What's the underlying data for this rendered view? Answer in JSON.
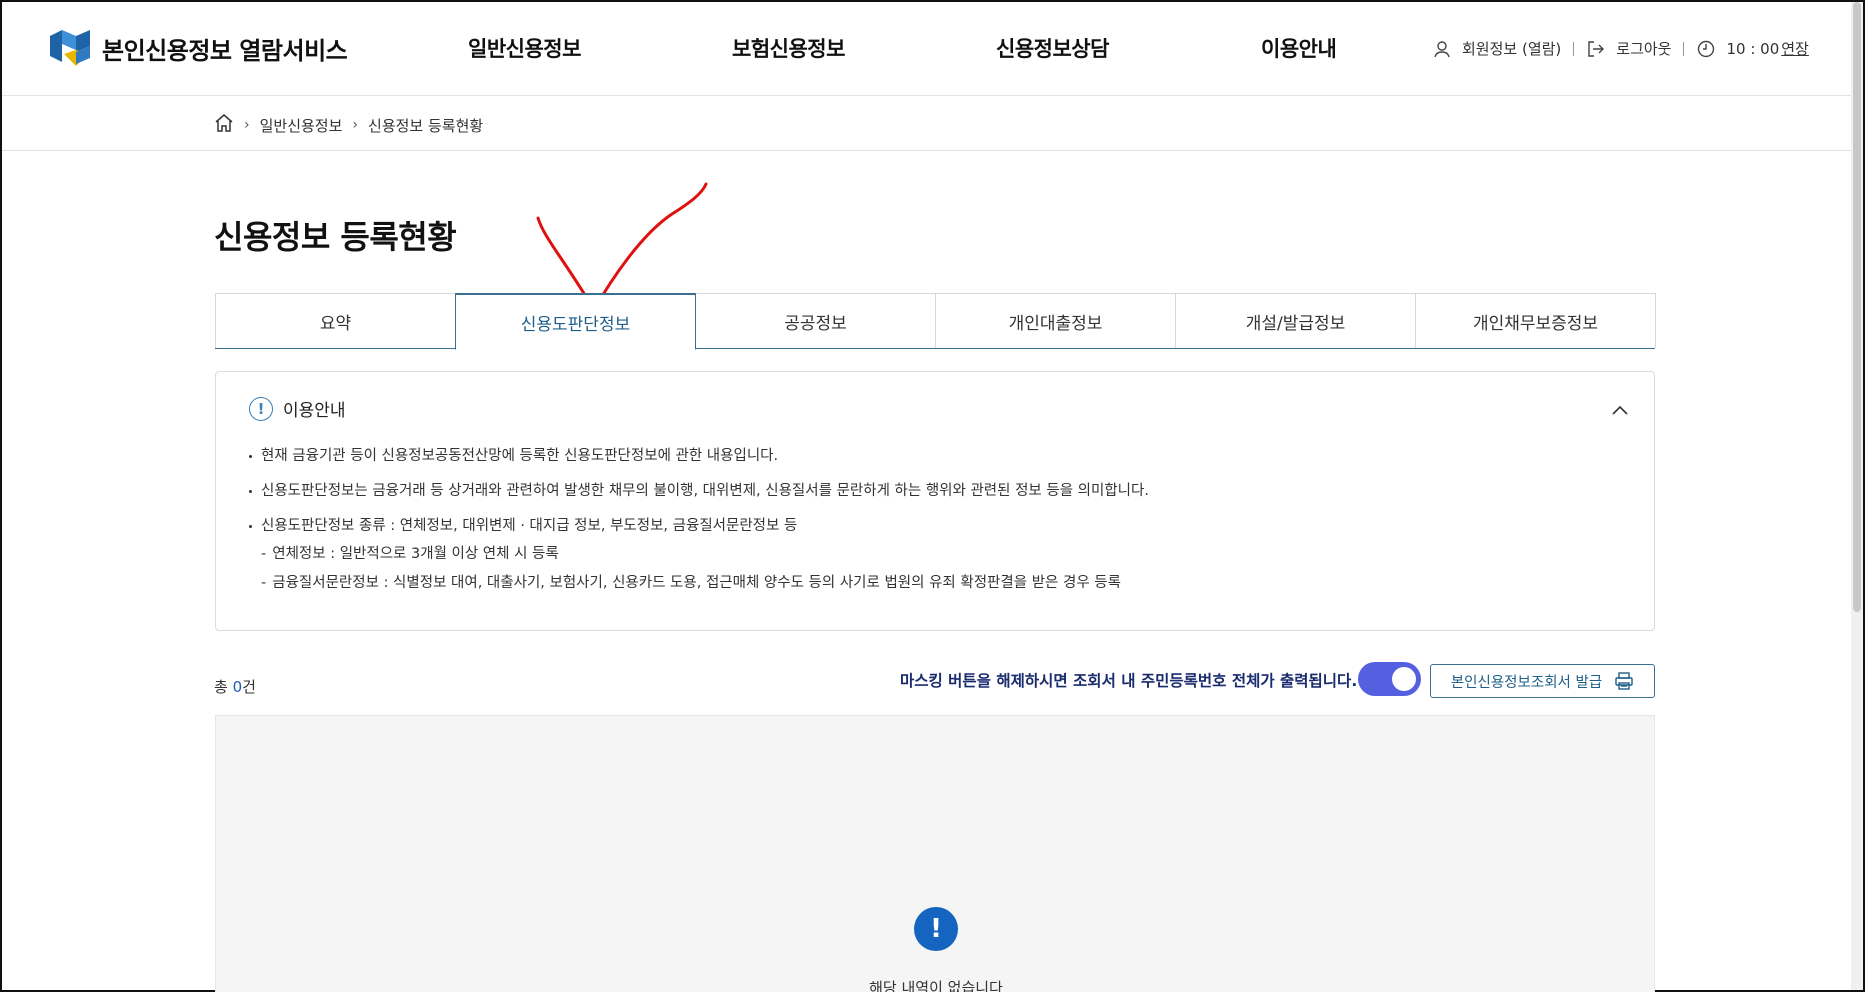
{
  "header": {
    "logo_text": "본인신용정보 열람서비스",
    "nav": [
      "일반신용정보",
      "보험신용정보",
      "신용정보상담",
      "이용안내"
    ],
    "member_info": "회원정보 (열람)",
    "logout": "로그아웃",
    "timer": "10 : 00",
    "extend": "연장"
  },
  "breadcrumb": [
    "일반신용정보",
    "신용정보 등록현황"
  ],
  "page_title": "신용정보 등록현황",
  "tabs": [
    "요약",
    "신용도판단정보",
    "공공정보",
    "개인대출정보",
    "개설/발급정보",
    "개인채무보증정보"
  ],
  "active_tab": "신용도판단정보",
  "info": {
    "title": "이용안내",
    "lines": [
      "현재 금융기관 등이 신용정보공동전산망에 등록한 신용도판단정보에 관한 내용입니다.",
      "신용도판단정보는 금융거래 등 상거래와 관련하여 발생한 채무의 불이행, 대위변제, 신용질서를 문란하게 하는 행위와 관련된 정보 등을 의미합니다.",
      "신용도판단정보 종류 : 연체정보, 대위변제 · 대지급 정보, 부도정보, 금융질서문란정보 등"
    ],
    "sub_lines": [
      "연체정보 : 일반적으로 3개월 이상 연체 시 등록",
      "금융질서문란정보 : 식별정보 대여, 대출사기, 보험사기, 신용카드 도용, 접근매체 양수도 등의 사기로 법원의 유죄 확정판결을 받은 경우 등록"
    ]
  },
  "count": {
    "prefix": "총 ",
    "value": "0",
    "suffix": "건"
  },
  "masking_message": "마스킹 버튼을 해제하시면 조회서 내 주민등록번호 전체가 출력됩니다.",
  "masking_toggle_on": true,
  "issue_button": "본인신용정보조회서 발급",
  "empty_text": "해당 내역이 없습니다",
  "colors": {
    "primary": "#1f5f8b",
    "toggle": "#5560e0",
    "empty_icon": "#1565c0",
    "annotation": "#e01010"
  }
}
